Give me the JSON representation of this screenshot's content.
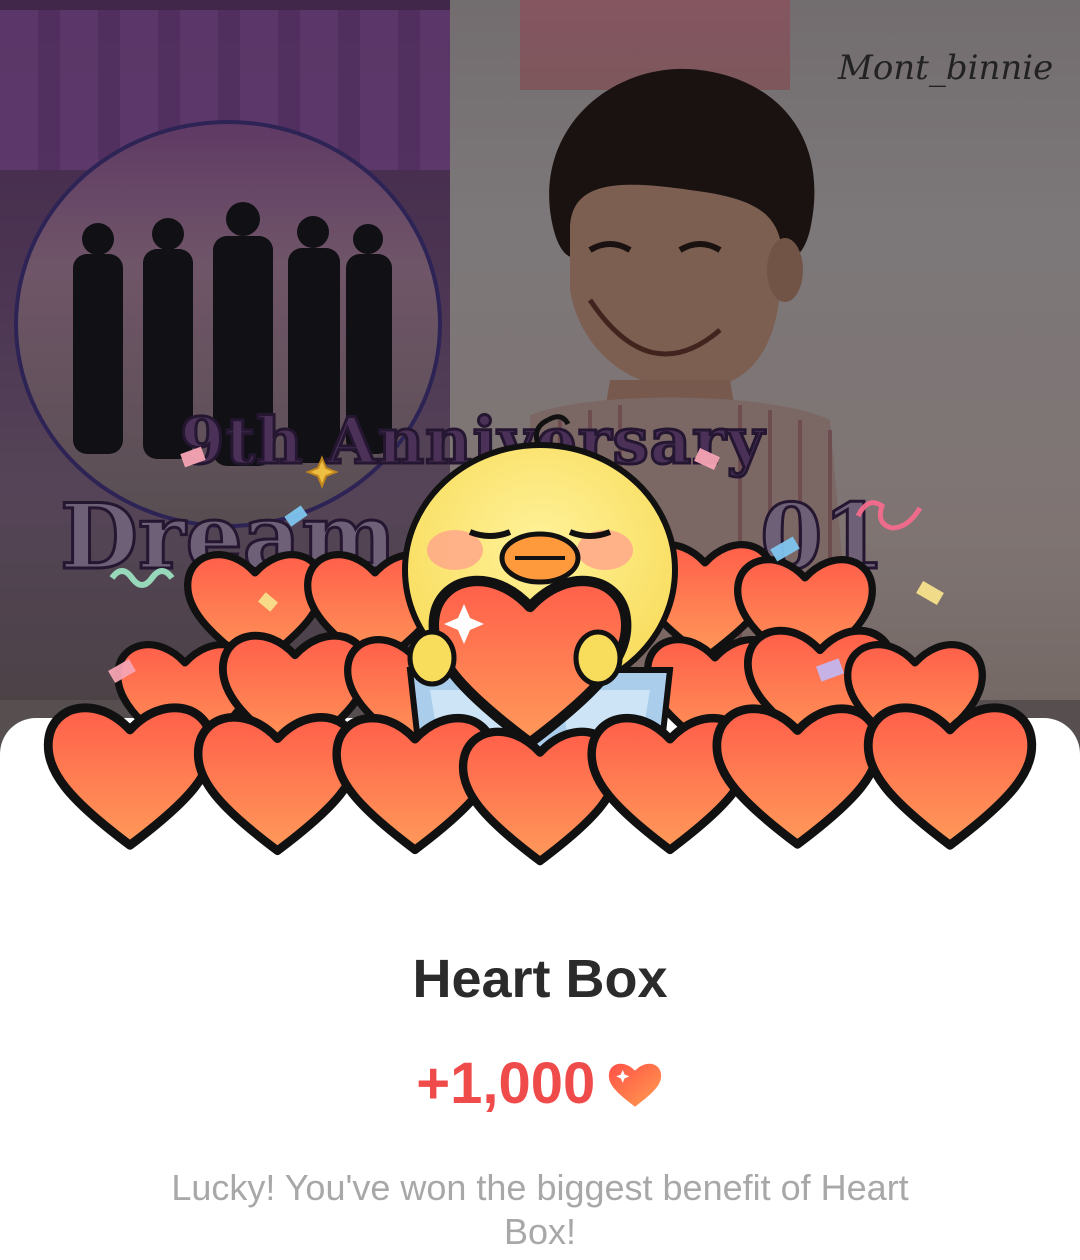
{
  "background": {
    "watermark": "Mont_binnie",
    "anniversary_line": "9th Anniversary",
    "dream_line_left": "Dream",
    "dream_line_right": "01"
  },
  "dialog": {
    "title": "Heart Box",
    "amount": "+1,000",
    "amount_icon": "heart-icon",
    "description": "Lucky! You've won the biggest benefit of Heart Box!",
    "colors": {
      "amount": "#f04b4b",
      "heart": "#f7653f",
      "title": "#2b2b2b",
      "description": "#a8a8a8"
    }
  },
  "illustration": {
    "subject": "chick-character-holding-heart-icon"
  }
}
